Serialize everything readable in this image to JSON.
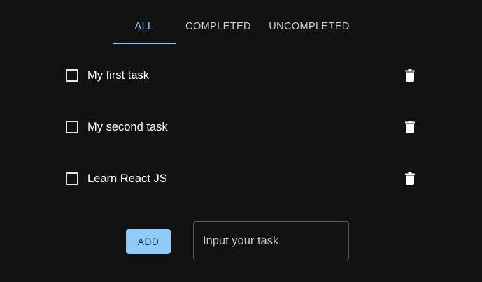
{
  "tabs": [
    {
      "label": "ALL",
      "active": true
    },
    {
      "label": "COMPLETED",
      "active": false
    },
    {
      "label": "UNCOMPLETED",
      "active": false
    }
  ],
  "tasks": [
    {
      "text": "My first task",
      "completed": false
    },
    {
      "text": "My second task",
      "completed": false
    },
    {
      "text": "Learn React JS",
      "completed": false
    }
  ],
  "add_form": {
    "button_label": "ADD",
    "input_placeholder": "Input your task",
    "input_value": ""
  },
  "icons": {
    "delete": "trash-icon",
    "checkbox": "checkbox-unchecked-icon"
  },
  "colors": {
    "background": "#121212",
    "accent": "#90caf9",
    "text": "#ffffff"
  }
}
